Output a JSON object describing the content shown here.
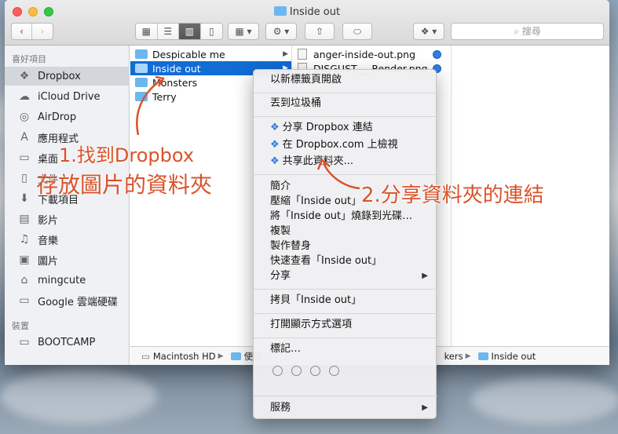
{
  "window": {
    "title": "Inside out"
  },
  "toolbar": {
    "search_placeholder": "搜尋"
  },
  "sidebar": {
    "favorites_header": "喜好項目",
    "favorites": [
      {
        "label": "Dropbox",
        "icon": "dropbox-icon"
      },
      {
        "label": "iCloud Drive",
        "icon": "cloud-icon"
      },
      {
        "label": "AirDrop",
        "icon": "airdrop-icon"
      },
      {
        "label": "應用程式",
        "icon": "applications-icon"
      },
      {
        "label": "桌面",
        "icon": "desktop-icon"
      },
      {
        "label": "文件",
        "icon": "documents-icon"
      },
      {
        "label": "下載項目",
        "icon": "downloads-icon"
      },
      {
        "label": "影片",
        "icon": "movies-icon"
      },
      {
        "label": "音樂",
        "icon": "music-icon"
      },
      {
        "label": "圖片",
        "icon": "pictures-icon"
      },
      {
        "label": "mingcute",
        "icon": "home-icon"
      },
      {
        "label": "Google 雲端硬碟",
        "icon": "drive-icon"
      }
    ],
    "devices_header": "裝置",
    "devices": [
      {
        "label": "BOOTCAMP",
        "icon": "disk-icon"
      }
    ]
  },
  "column1": [
    "Despicable me",
    "Inside out",
    "Monsters",
    "Terry"
  ],
  "column2": [
    "anger-inside-out.png",
    "DISGUST___Render.png"
  ],
  "pathbar": {
    "items": [
      "Macintosh HD",
      "使用",
      "kers",
      "Inside out"
    ]
  },
  "context_menu": {
    "items": [
      "以新標籤頁開啟",
      "丟到垃圾桶",
      "分享 Dropbox 連結",
      "在 Dropbox.com 上檢視",
      "共享此資料夾...",
      "簡介",
      "壓縮「Inside out」",
      "將「Inside out」燒錄到光碟…",
      "複製",
      "製作替身",
      "快速查看「Inside out」",
      "分享",
      "拷貝「Inside out」",
      "打開顯示方式選項",
      "標記…",
      "服務"
    ]
  },
  "annotations": {
    "step1_line1": "1.找到Dropbox",
    "step1_line2": "存放圖片的資料夾",
    "step2": "2.分享資料夾的連結"
  },
  "colors": {
    "selection": "#116cd6",
    "annotation": "#d9532a",
    "folder": "#6cb8ee",
    "dropbox": "#2c7ed8"
  }
}
